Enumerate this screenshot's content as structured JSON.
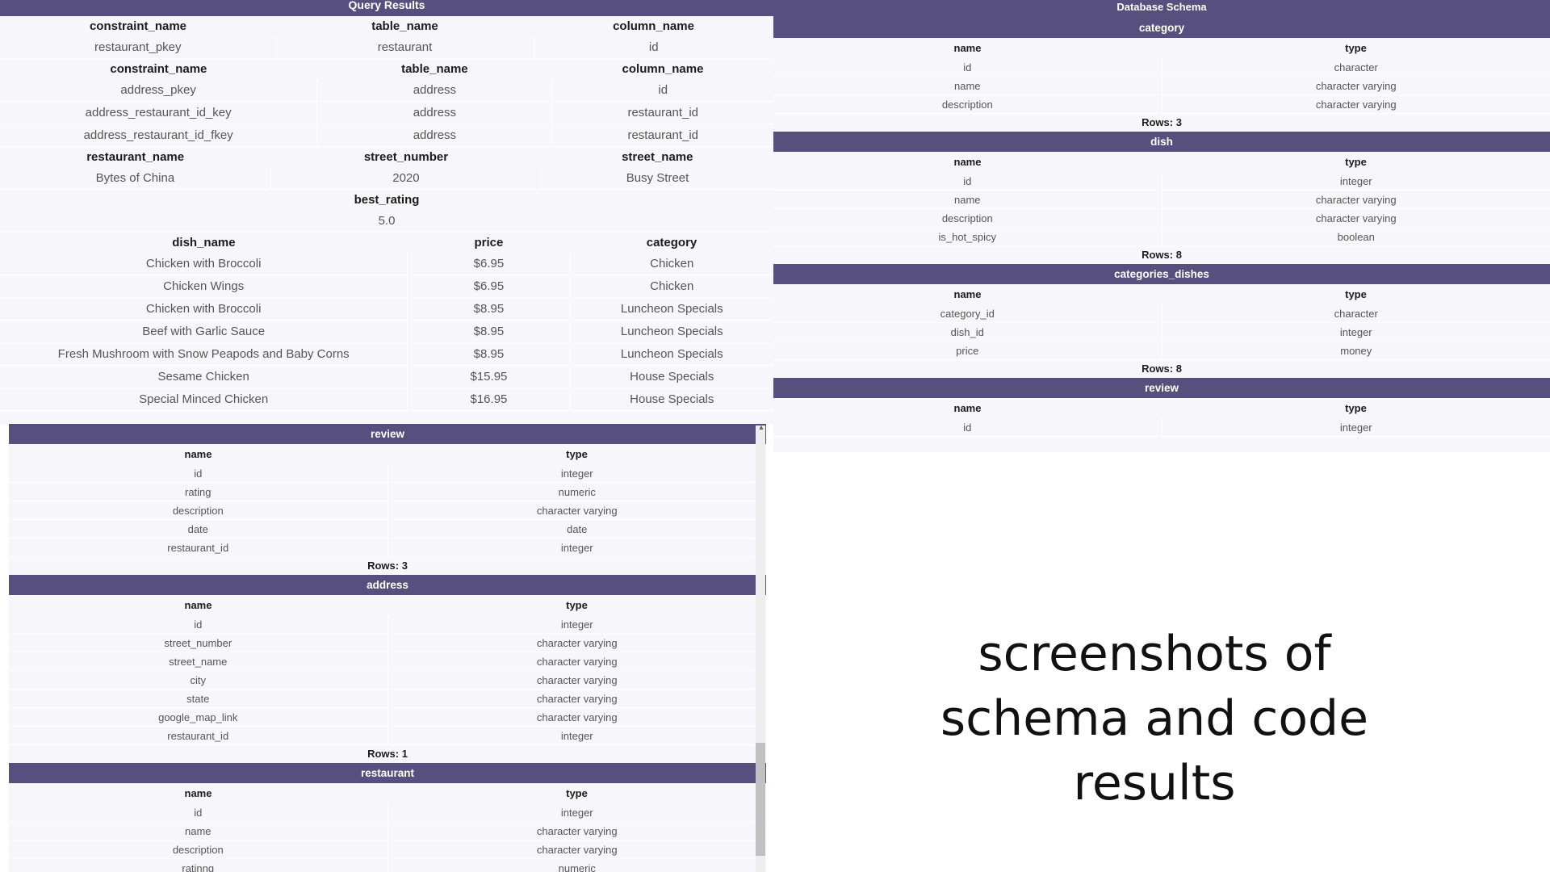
{
  "query_results": {
    "title": "Query Results",
    "tables": [
      {
        "widths": [
          "35.7%",
          "33.3%",
          "31%"
        ],
        "headers": [
          "constraint_name",
          "table_name",
          "column_name"
        ],
        "rows": [
          [
            "restaurant_pkey",
            "restaurant",
            "id"
          ]
        ]
      },
      {
        "widths": [
          "41%",
          "30.4%",
          "28.6%"
        ],
        "headers": [
          "constraint_name",
          "table_name",
          "column_name"
        ],
        "rows": [
          [
            "address_pkey",
            "address",
            "id"
          ],
          [
            "address_restaurant_id_key",
            "address",
            "restaurant_id"
          ],
          [
            "address_restaurant_id_fkey",
            "address",
            "restaurant_id"
          ]
        ]
      },
      {
        "widths": [
          "35%",
          "35%",
          "30%"
        ],
        "headers": [
          "restaurant_name",
          "street_number",
          "street_name"
        ],
        "rows": [
          [
            "Bytes of China",
            "2020",
            "Busy Street"
          ]
        ]
      },
      {
        "widths": [
          "102%"
        ],
        "headers": [
          "best_rating"
        ],
        "rows": [
          [
            "5.0"
          ]
        ]
      },
      {
        "widths": [
          "52.7%",
          "21%",
          "26.3%"
        ],
        "headers": [
          "dish_name",
          "price",
          "category"
        ],
        "rows": [
          [
            "Chicken with Broccoli",
            "$6.95",
            "Chicken"
          ],
          [
            "Chicken Wings",
            "$6.95",
            "Chicken"
          ],
          [
            "Chicken with Broccoli",
            "$8.95",
            "Luncheon Specials"
          ],
          [
            "Beef with Garlic Sauce",
            "$8.95",
            "Luncheon Specials"
          ],
          [
            "Fresh Mushroom with Snow Peapods and Baby Corns",
            "$8.95",
            "Luncheon Specials"
          ],
          [
            "Sesame Chicken",
            "$15.95",
            "House Specials"
          ],
          [
            "Special Minced Chicken",
            "$16.95",
            "House Specials"
          ]
        ]
      }
    ]
  },
  "lower_schema": {
    "tables": [
      {
        "name": "review",
        "headers": [
          "name",
          "type"
        ],
        "rows": [
          [
            "id",
            "integer"
          ],
          [
            "rating",
            "numeric"
          ],
          [
            "description",
            "character varying"
          ],
          [
            "date",
            "date"
          ],
          [
            "restaurant_id",
            "integer"
          ]
        ],
        "rows_label": "Rows: 3"
      },
      {
        "name": "address",
        "headers": [
          "name",
          "type"
        ],
        "rows": [
          [
            "id",
            "integer"
          ],
          [
            "street_number",
            "character varying"
          ],
          [
            "street_name",
            "character varying"
          ],
          [
            "city",
            "character varying"
          ],
          [
            "state",
            "character varying"
          ],
          [
            "google_map_link",
            "character varying"
          ],
          [
            "restaurant_id",
            "integer"
          ]
        ],
        "rows_label": "Rows: 1"
      },
      {
        "name": "restaurant",
        "headers": [
          "name",
          "type"
        ],
        "rows": [
          [
            "id",
            "integer"
          ],
          [
            "name",
            "character varying"
          ],
          [
            "description",
            "character varying"
          ],
          [
            "ratinng",
            "numeric"
          ]
        ],
        "rows_label": ""
      }
    ]
  },
  "database_schema": {
    "title": "Database Schema",
    "tables": [
      {
        "name": "category",
        "headers": [
          "name",
          "type"
        ],
        "rows": [
          [
            "id",
            "character"
          ],
          [
            "name",
            "character varying"
          ],
          [
            "description",
            "character varying"
          ]
        ],
        "rows_label": "Rows: 3"
      },
      {
        "name": "dish",
        "headers": [
          "name",
          "type"
        ],
        "rows": [
          [
            "id",
            "integer"
          ],
          [
            "name",
            "character varying"
          ],
          [
            "description",
            "character varying"
          ],
          [
            "is_hot_spicy",
            "boolean"
          ]
        ],
        "rows_label": "Rows: 8"
      },
      {
        "name": "categories_dishes",
        "headers": [
          "name",
          "type"
        ],
        "rows": [
          [
            "category_id",
            "character"
          ],
          [
            "dish_id",
            "integer"
          ],
          [
            "price",
            "money"
          ]
        ],
        "rows_label": "Rows: 8"
      },
      {
        "name": "review",
        "headers": [
          "name",
          "type"
        ],
        "rows": [
          [
            "id",
            "integer"
          ]
        ],
        "rows_label": ""
      }
    ]
  },
  "caption": {
    "lines": [
      "screenshots of",
      "schema and code",
      "results"
    ]
  },
  "colors": {
    "header_bar": "#574f7d",
    "panel_bg": "#f7f6fa"
  }
}
